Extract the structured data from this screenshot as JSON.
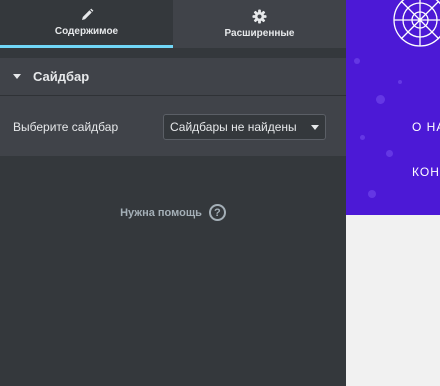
{
  "tabs": [
    {
      "label": "Содержимое",
      "icon": "pencil-icon",
      "active": true
    },
    {
      "label": "Расширенные",
      "icon": "gear-icon",
      "active": false
    }
  ],
  "section": {
    "title": "Сайдбар",
    "control_label": "Выберите сайдбар",
    "select_value": "Сайдбары не найдены"
  },
  "help": {
    "label": "Нужна помощь",
    "icon": "question-circle-icon"
  },
  "preview": {
    "hero_line1": "О НА",
    "hero_line2": "КОН",
    "colors": {
      "hero": "#4c19d6",
      "accent": "#71d7f7",
      "panel": "#34383c"
    }
  }
}
